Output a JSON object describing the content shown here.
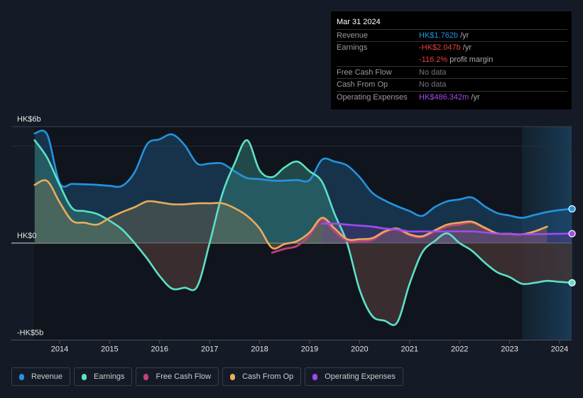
{
  "tooltip": {
    "date": "Mar 31 2024",
    "rows": [
      {
        "label": "Revenue",
        "value": "HK$1.762b",
        "unit": " /yr",
        "color": "#2394df"
      },
      {
        "label": "Earnings",
        "value": "-HK$2.047b",
        "unit": " /yr",
        "color": "#e64141"
      },
      {
        "label": "",
        "value": "-116.2%",
        "unit": " profit margin",
        "color": "#e64141"
      },
      {
        "label": "Free Cash Flow",
        "value": "No data",
        "unit": "",
        "color": "#777777"
      },
      {
        "label": "Cash From Op",
        "value": "No data",
        "unit": "",
        "color": "#777777"
      },
      {
        "label": "Operating Expenses",
        "value": "HK$486.342m",
        "unit": " /yr",
        "color": "#a349f2"
      }
    ]
  },
  "legend": [
    {
      "label": "Revenue",
      "color": "#2394df"
    },
    {
      "label": "Earnings",
      "color": "#5ce1c8"
    },
    {
      "label": "Free Cash Flow",
      "color": "#c4417e"
    },
    {
      "label": "Cash From Op",
      "color": "#e8ac5a"
    },
    {
      "label": "Operating Expenses",
      "color": "#a349f2"
    }
  ],
  "chart_data": {
    "type": "area",
    "title": "",
    "xlabel": "",
    "ylabel": "",
    "y_tick_labels": [
      {
        "value": 6,
        "label": "HK$6b"
      },
      {
        "value": 0,
        "label": "HK$0"
      },
      {
        "value": -5,
        "label": "-HK$5b"
      }
    ],
    "ylim": [
      -5,
      6
    ],
    "xlim": [
      2013.5,
      2024.25
    ],
    "x_ticks": [
      2014,
      2015,
      2016,
      2017,
      2018,
      2019,
      2020,
      2021,
      2022,
      2023,
      2024
    ],
    "forecast_shade_from": 2023.25,
    "units": "HK$ billions",
    "grid": true,
    "legend_position": "bottom",
    "series": [
      {
        "name": "Revenue",
        "color": "#2394df",
        "end_marker": true,
        "points": [
          [
            2013.5,
            5.65
          ],
          [
            2013.75,
            5.6
          ],
          [
            2014.0,
            3.1
          ],
          [
            2014.25,
            3.05
          ],
          [
            2014.5,
            3.03
          ],
          [
            2014.75,
            3.0
          ],
          [
            2015.0,
            2.95
          ],
          [
            2015.25,
            2.95
          ],
          [
            2015.5,
            3.65
          ],
          [
            2015.75,
            5.1
          ],
          [
            2016.0,
            5.35
          ],
          [
            2016.25,
            5.6
          ],
          [
            2016.5,
            5.05
          ],
          [
            2016.75,
            4.1
          ],
          [
            2017.0,
            4.1
          ],
          [
            2017.25,
            4.1
          ],
          [
            2017.5,
            3.7
          ],
          [
            2017.75,
            3.35
          ],
          [
            2018.0,
            3.3
          ],
          [
            2018.25,
            3.22
          ],
          [
            2018.5,
            3.22
          ],
          [
            2018.75,
            3.25
          ],
          [
            2019.0,
            3.25
          ],
          [
            2019.25,
            4.3
          ],
          [
            2019.5,
            4.2
          ],
          [
            2019.75,
            4.0
          ],
          [
            2020.0,
            3.4
          ],
          [
            2020.25,
            2.6
          ],
          [
            2020.5,
            2.2
          ],
          [
            2020.75,
            1.9
          ],
          [
            2021.0,
            1.65
          ],
          [
            2021.25,
            1.4
          ],
          [
            2021.5,
            1.85
          ],
          [
            2021.75,
            2.15
          ],
          [
            2022.0,
            2.25
          ],
          [
            2022.25,
            2.35
          ],
          [
            2022.5,
            1.9
          ],
          [
            2022.75,
            1.55
          ],
          [
            2023.0,
            1.42
          ],
          [
            2023.25,
            1.3
          ],
          [
            2023.5,
            1.45
          ],
          [
            2023.75,
            1.6
          ],
          [
            2024.0,
            1.7
          ],
          [
            2024.25,
            1.762
          ]
        ]
      },
      {
        "name": "Earnings",
        "color": "#5ce1c8",
        "end_marker": true,
        "points": [
          [
            2013.5,
            5.3
          ],
          [
            2013.75,
            4.4
          ],
          [
            2014.0,
            3.0
          ],
          [
            2014.25,
            1.8
          ],
          [
            2014.5,
            1.65
          ],
          [
            2014.75,
            1.5
          ],
          [
            2015.0,
            1.15
          ],
          [
            2015.25,
            0.7
          ],
          [
            2015.5,
            0.0
          ],
          [
            2015.75,
            -0.8
          ],
          [
            2016.0,
            -1.7
          ],
          [
            2016.25,
            -2.35
          ],
          [
            2016.5,
            -2.3
          ],
          [
            2016.75,
            -2.25
          ],
          [
            2017.0,
            0.0
          ],
          [
            2017.25,
            2.5
          ],
          [
            2017.5,
            4.1
          ],
          [
            2017.75,
            5.3
          ],
          [
            2018.0,
            3.75
          ],
          [
            2018.25,
            3.4
          ],
          [
            2018.5,
            3.9
          ],
          [
            2018.75,
            4.2
          ],
          [
            2019.0,
            3.7
          ],
          [
            2019.25,
            3.15
          ],
          [
            2019.5,
            1.5
          ],
          [
            2019.75,
            0.0
          ],
          [
            2020.0,
            -2.4
          ],
          [
            2020.25,
            -3.75
          ],
          [
            2020.5,
            -4.0
          ],
          [
            2020.75,
            -4.1
          ],
          [
            2021.0,
            -2.1
          ],
          [
            2021.25,
            -0.5
          ],
          [
            2021.5,
            0.1
          ],
          [
            2021.75,
            0.5
          ],
          [
            2022.0,
            0.0
          ],
          [
            2022.25,
            -0.4
          ],
          [
            2022.5,
            -1.0
          ],
          [
            2022.75,
            -1.5
          ],
          [
            2023.0,
            -1.75
          ],
          [
            2023.25,
            -2.1
          ],
          [
            2023.5,
            -2.05
          ],
          [
            2023.75,
            -1.95
          ],
          [
            2024.0,
            -2.0
          ],
          [
            2024.25,
            -2.047
          ]
        ]
      },
      {
        "name": "Free Cash Flow",
        "color": "#c4417e",
        "end_marker": false,
        "points": [
          [
            2018.25,
            -0.5
          ],
          [
            2018.5,
            -0.3
          ],
          [
            2018.75,
            -0.15
          ],
          [
            2019.0,
            0.4
          ],
          [
            2019.25,
            1.2
          ],
          [
            2019.5,
            0.6
          ],
          [
            2019.75,
            0.1
          ],
          [
            2020.0,
            0.1
          ],
          [
            2020.25,
            0.15
          ],
          [
            2020.5,
            0.55
          ],
          [
            2020.75,
            0.7
          ],
          [
            2021.0,
            0.4
          ],
          [
            2021.25,
            0.3
          ],
          [
            2021.5,
            0.6
          ],
          [
            2021.75,
            0.85
          ],
          [
            2022.0,
            0.95
          ],
          [
            2022.25,
            1.05
          ],
          [
            2022.5,
            0.75
          ],
          [
            2022.75,
            0.5
          ],
          [
            2023.0,
            0.45
          ],
          [
            2023.25,
            0.45
          ],
          [
            2023.5,
            0.6
          ],
          [
            2023.75,
            0.85
          ]
        ]
      },
      {
        "name": "Cash From Op",
        "color": "#e8ac5a",
        "end_marker": false,
        "points": [
          [
            2013.5,
            3.0
          ],
          [
            2013.75,
            3.2
          ],
          [
            2014.0,
            2.1
          ],
          [
            2014.25,
            1.15
          ],
          [
            2014.5,
            1.05
          ],
          [
            2014.75,
            0.95
          ],
          [
            2015.0,
            1.3
          ],
          [
            2015.25,
            1.6
          ],
          [
            2015.5,
            1.85
          ],
          [
            2015.75,
            2.15
          ],
          [
            2016.0,
            2.1
          ],
          [
            2016.25,
            2.0
          ],
          [
            2016.5,
            2.0
          ],
          [
            2016.75,
            2.05
          ],
          [
            2017.0,
            2.05
          ],
          [
            2017.25,
            2.05
          ],
          [
            2017.5,
            1.8
          ],
          [
            2017.75,
            1.4
          ],
          [
            2018.0,
            0.75
          ],
          [
            2018.25,
            -0.25
          ],
          [
            2018.5,
            -0.05
          ],
          [
            2018.75,
            0.1
          ],
          [
            2019.0,
            0.55
          ],
          [
            2019.25,
            1.3
          ],
          [
            2019.5,
            0.75
          ],
          [
            2019.75,
            0.2
          ],
          [
            2020.0,
            0.2
          ],
          [
            2020.25,
            0.25
          ],
          [
            2020.5,
            0.6
          ],
          [
            2020.75,
            0.75
          ],
          [
            2021.0,
            0.45
          ],
          [
            2021.25,
            0.35
          ],
          [
            2021.5,
            0.65
          ],
          [
            2021.75,
            0.95
          ],
          [
            2022.0,
            1.05
          ],
          [
            2022.25,
            1.1
          ],
          [
            2022.5,
            0.8
          ],
          [
            2022.75,
            0.5
          ],
          [
            2023.0,
            0.48
          ],
          [
            2023.25,
            0.45
          ],
          [
            2023.5,
            0.6
          ],
          [
            2023.75,
            0.85
          ]
        ]
      },
      {
        "name": "Operating Expenses",
        "color": "#a349f2",
        "end_marker": true,
        "points": [
          [
            2019.25,
            1.0
          ],
          [
            2019.5,
            1.0
          ],
          [
            2019.75,
            0.95
          ],
          [
            2020.0,
            0.9
          ],
          [
            2020.25,
            0.85
          ],
          [
            2020.5,
            0.75
          ],
          [
            2020.75,
            0.7
          ],
          [
            2021.0,
            0.6
          ],
          [
            2021.25,
            0.6
          ],
          [
            2021.5,
            0.6
          ],
          [
            2021.75,
            0.6
          ],
          [
            2022.0,
            0.6
          ],
          [
            2022.25,
            0.6
          ],
          [
            2022.5,
            0.55
          ],
          [
            2022.75,
            0.48
          ],
          [
            2023.0,
            0.47
          ],
          [
            2023.25,
            0.45
          ],
          [
            2023.5,
            0.46
          ],
          [
            2023.75,
            0.47
          ],
          [
            2024.0,
            0.48
          ],
          [
            2024.25,
            0.486
          ]
        ]
      }
    ]
  }
}
